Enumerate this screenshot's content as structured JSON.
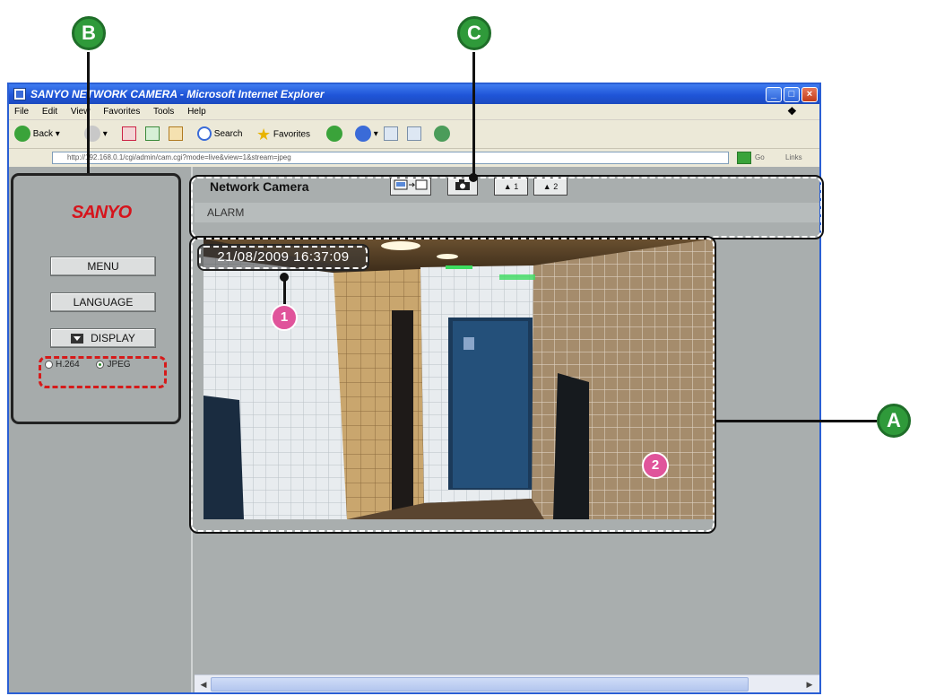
{
  "browser": {
    "title": "SANYO NETWORK CAMERA - Microsoft Internet Explorer",
    "menu": [
      "File",
      "Edit",
      "View",
      "Favorites",
      "Tools",
      "Help"
    ],
    "toolbar": {
      "back_label": "Back",
      "search_label": "Search",
      "favorites_label": "Favorites"
    },
    "address_text": "http://192.168.0.1/cgi/admin/cam.cgi?mode=live&view=1&stream=jpeg",
    "go_label": "Go",
    "links_label": "Links"
  },
  "sidebar": {
    "logo": "SANYO",
    "buttons": {
      "menu": "MENU",
      "language": "LANGUAGE",
      "display": "DISPLAY"
    },
    "codec_options": [
      {
        "label": "H.264",
        "selected": false
      },
      {
        "label": "JPEG",
        "selected": true
      }
    ]
  },
  "camera_bar": {
    "title": "Network Camera",
    "buttons": {
      "alarm1": "1",
      "alarm2": "2"
    },
    "alarm_label": "ALARM"
  },
  "video": {
    "timestamp": "21/08/2009 16:37:09"
  },
  "annotations": {
    "callouts": {
      "a": "A",
      "b": "B",
      "c": "C"
    },
    "markers": {
      "one": "1",
      "two": "2"
    }
  },
  "colors": {
    "callout_green": "#2f9a3a",
    "marker_pink": "#e0549b",
    "logo_red": "#d6141c",
    "title_blue": "#1f55d8"
  }
}
